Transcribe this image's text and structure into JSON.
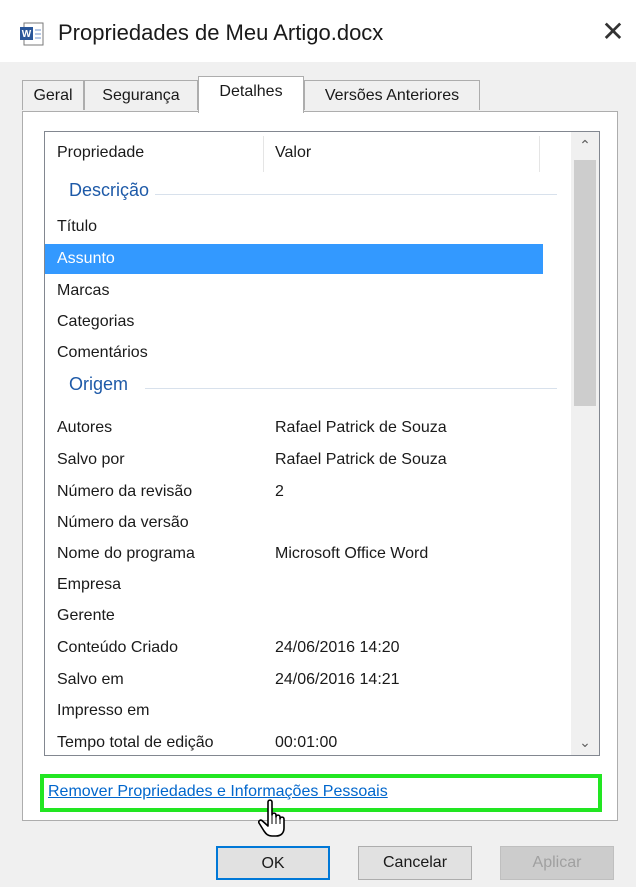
{
  "window": {
    "title": "Propriedades de Meu Artigo.docx",
    "close_symbol": "✕",
    "icon": "word-document-icon"
  },
  "tabs": [
    {
      "label": "Geral",
      "active": false
    },
    {
      "label": "Segurança",
      "active": false
    },
    {
      "label": "Detalhes",
      "active": true
    },
    {
      "label": "Versões Anteriores",
      "active": false
    }
  ],
  "list": {
    "headers": {
      "property": "Propriedade",
      "value": "Valor"
    },
    "groups": {
      "descricao": "Descrição",
      "origem": "Origem"
    },
    "rows": [
      {
        "name": "Título",
        "value": ""
      },
      {
        "name": "Assunto",
        "value": "",
        "selected": true
      },
      {
        "name": "Marcas",
        "value": ""
      },
      {
        "name": "Categorias",
        "value": ""
      },
      {
        "name": "Comentários",
        "value": ""
      },
      {
        "name": "Autores",
        "value": "Rafael Patrick de Souza"
      },
      {
        "name": "Salvo por",
        "value": "Rafael Patrick de Souza"
      },
      {
        "name": "Número da revisão",
        "value": "2"
      },
      {
        "name": "Número da versão",
        "value": ""
      },
      {
        "name": "Nome do programa",
        "value": "Microsoft Office Word"
      },
      {
        "name": "Empresa",
        "value": ""
      },
      {
        "name": "Gerente",
        "value": ""
      },
      {
        "name": "Conteúdo Criado",
        "value": "24/06/2016 14:20"
      },
      {
        "name": "Salvo em",
        "value": "24/06/2016 14:21"
      },
      {
        "name": "Impresso em",
        "value": ""
      },
      {
        "name": "Tempo total de edição",
        "value": "00:01:00"
      }
    ],
    "scroll_up_symbol": "⌃",
    "scroll_down_symbol": "⌄"
  },
  "link": {
    "remove_label": "Remover Propriedades e Informações Pessoais"
  },
  "buttons": {
    "ok": "OK",
    "cancel": "Cancelar",
    "apply": "Aplicar"
  },
  "colors": {
    "selection": "#3399ff",
    "highlight_box": "#22e622",
    "link": "#0066cc",
    "group_header": "#1e5aa8"
  }
}
